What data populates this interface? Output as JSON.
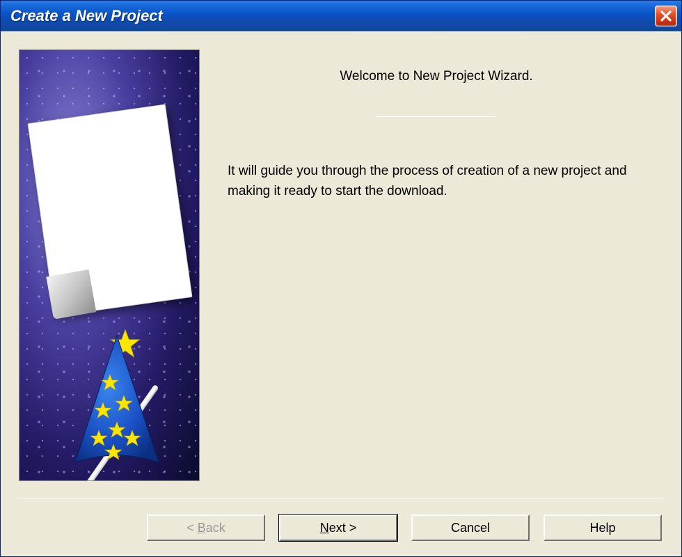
{
  "window": {
    "title": "Create a New Project"
  },
  "content": {
    "welcome": "Welcome to New Project Wizard.",
    "body": "It will guide you through the process of creation of a new project and making it ready to start the download."
  },
  "buttons": {
    "back": "< Back",
    "next": "Next >",
    "cancel": "Cancel",
    "help": "Help"
  }
}
